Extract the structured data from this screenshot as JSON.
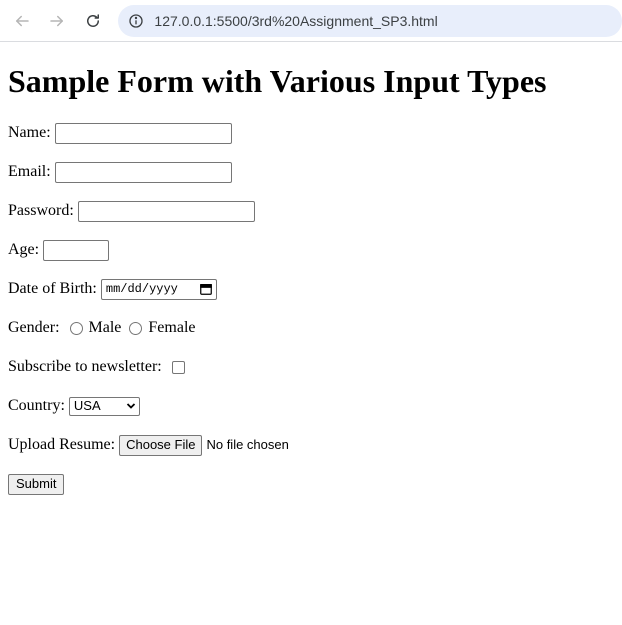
{
  "browser": {
    "url": "127.0.0.1:5500/3rd%20Assignment_SP3.html",
    "back_icon": "back-arrow-icon",
    "forward_icon": "forward-arrow-icon",
    "reload_icon": "reload-icon",
    "info_icon": "site-info-icon"
  },
  "page": {
    "title": "Sample Form with Various Input Types"
  },
  "form": {
    "name_label": "Name:",
    "name_value": "",
    "email_label": "Email:",
    "email_value": "",
    "password_label": "Password:",
    "password_value": "",
    "age_label": "Age:",
    "age_value": "",
    "dob_label": "Date of Birth:",
    "dob_placeholder": "mm/dd/yyyy",
    "gender_label": "Gender:",
    "gender_options": [
      "Male",
      "Female"
    ],
    "subscribe_label": "Subscribe to newsletter:",
    "country_label": "Country:",
    "country_value": "USA",
    "resume_label": "Upload Resume:",
    "resume_button": "Choose File",
    "resume_status": "No file chosen",
    "submit_label": "Submit"
  }
}
